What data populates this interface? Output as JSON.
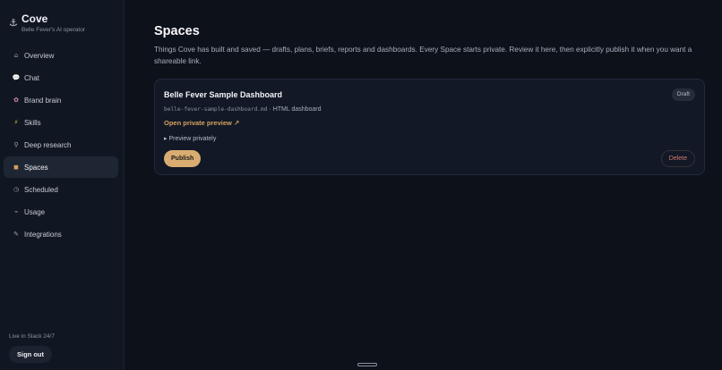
{
  "brand": {
    "icon": "anchor-icon",
    "name": "Cove",
    "subtitle": "Belle Fever's AI operator"
  },
  "nav": [
    {
      "label": "Overview",
      "icon": "home-icon",
      "glyph": "⌂",
      "active": false
    },
    {
      "label": "Chat",
      "icon": "speech-bubble-icon",
      "glyph": "💬",
      "active": false
    },
    {
      "label": "Brand brain",
      "icon": "brain-icon",
      "glyph": "✿",
      "active": false
    },
    {
      "label": "Skills",
      "icon": "lightning-icon",
      "glyph": "⚡",
      "active": false
    },
    {
      "label": "Deep research",
      "icon": "magnifier-icon",
      "glyph": "⚲",
      "active": false
    },
    {
      "label": "Spaces",
      "icon": "package-icon",
      "glyph": "◼",
      "active": true
    },
    {
      "label": "Scheduled",
      "icon": "clock-icon",
      "glyph": "◷",
      "active": false
    },
    {
      "label": "Usage",
      "icon": "chart-icon",
      "glyph": "⌁",
      "active": false
    },
    {
      "label": "Integrations",
      "icon": "plug-icon",
      "glyph": "✎",
      "active": false
    }
  ],
  "footer": {
    "slack": "Live in Slack 24/7",
    "signout": "Sign out"
  },
  "page": {
    "title": "Spaces",
    "description": "Things Cove has built and saved — drafts, plans, briefs, reports and dashboards. Every Space starts private. Review it here, then explicitly publish it when you want a shareable link."
  },
  "space": {
    "title": "Belle Fever Sample Dashboard",
    "status": "Draft",
    "filename": "belle-fever-sample-dashboard.md",
    "type": "· HTML dashboard",
    "open_preview": "Open private preview ↗",
    "preview_toggle": "▸ Preview privately",
    "publish": "Publish",
    "delete": "Delete"
  },
  "colors": {
    "accent": "#d4a25c",
    "publish_bg": "#d9ad72",
    "delete": "#d27a72",
    "background": "#0d111a",
    "sidebar": "#111722"
  }
}
